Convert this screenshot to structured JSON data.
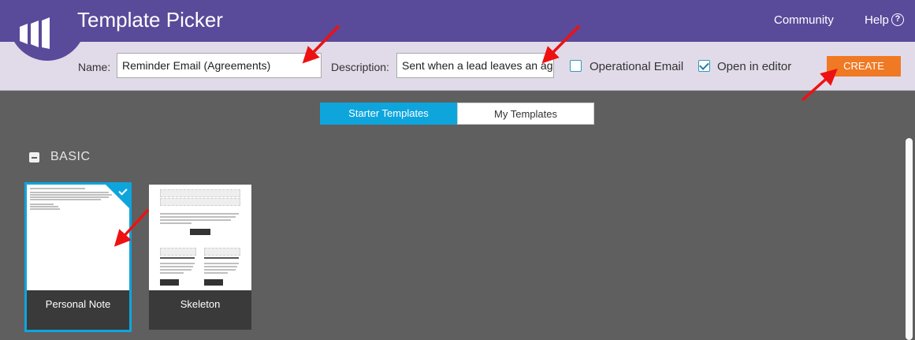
{
  "header": {
    "title": "Template Picker",
    "links": {
      "community": "Community",
      "help": "Help"
    },
    "help_icon_glyph": "?",
    "bg_color": "#5a4a9a"
  },
  "toolbar": {
    "name_label": "Name:",
    "name_value": "Reminder Email (Agreements)",
    "description_label": "Description:",
    "description_value": "Sent when a lead leaves an agre",
    "operational_email_label": "Operational Email",
    "operational_email_checked": false,
    "open_in_editor_label": "Open in editor",
    "open_in_editor_checked": true,
    "create_label": "CREATE",
    "create_color": "#f07924"
  },
  "tabs": [
    {
      "label": "Starter Templates",
      "active": true
    },
    {
      "label": "My Templates",
      "active": false
    }
  ],
  "section": {
    "title": "BASIC",
    "cards": [
      {
        "label": "Personal Note",
        "selected": true
      },
      {
        "label": "Skeleton",
        "selected": false
      }
    ]
  },
  "annotation_color": "#ee1111"
}
